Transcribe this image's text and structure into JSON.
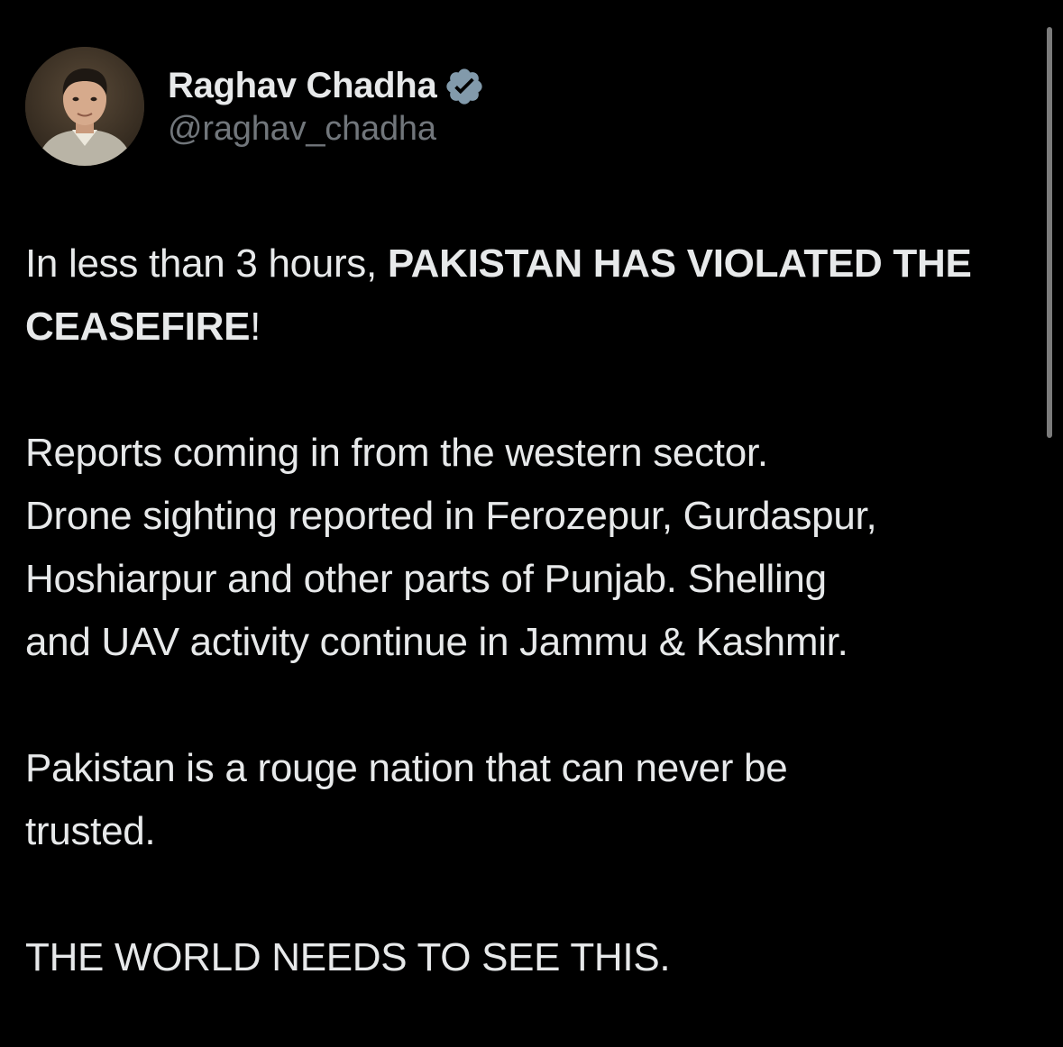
{
  "author": {
    "display_name": "Raghav Chadha",
    "handle": "@raghav_chadha",
    "verified_icon": "verified-badge-icon"
  },
  "tweet": {
    "p1_normal": "In less than 3 hours, ",
    "p1_bold": "PAKISTAN HAS VIOLATED THE CEASEFIRE",
    "p1_end": "!",
    "p2_line1": "Reports coming in from the western sector.",
    "p2_line2": "Drone sighting reported in Ferozepur, Gurdaspur,",
    "p2_line3": "Hoshiarpur and other parts of Punjab. Shelling",
    "p2_line4": "and UAV activity continue in Jammu & Kashmir.",
    "p3": "Pakistan is a rouge nation that can never be trusted.",
    "p4": "THE WORLD NEEDS TO SEE THIS."
  },
  "colors": {
    "background": "#000000",
    "text": "#e7e9ea",
    "secondary_text": "#71767b",
    "scrollbar": "#7b7b7b"
  }
}
